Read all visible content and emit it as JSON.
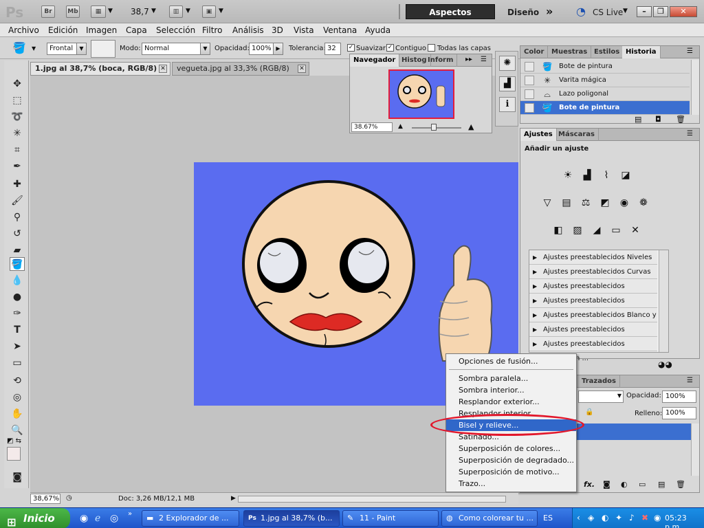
{
  "appbar": {
    "logo": "Ps",
    "btn_br": "Br",
    "btn_mb": "Mb",
    "zoom": "38,7",
    "workspace_active": "Aspectos esenciales",
    "workspace_design": "Diseño",
    "more": "»",
    "cslive": "CS Live"
  },
  "menu": [
    "Archivo",
    "Edición",
    "Imagen",
    "Capa",
    "Selección",
    "Filtro",
    "Análisis",
    "3D",
    "Vista",
    "Ventana",
    "Ayuda"
  ],
  "options": {
    "fill_source": "Frontal",
    "mode_label": "Modo:",
    "mode_value": "Normal",
    "opacity_label": "Opacidad:",
    "opacity_value": "100%",
    "tolerance_label": "Tolerancia:",
    "tolerance_value": "32",
    "antialias_label": "Suavizar",
    "contiguous_label": "Contiguo",
    "all_layers_label": "Todas las capas"
  },
  "tabs": [
    {
      "label": "1.jpg al 38,7% (boca, RGB/8) *"
    },
    {
      "label": "vegueta.jpg al 33,3% (RGB/8)"
    }
  ],
  "navigator": {
    "tabs": [
      "Navegador",
      "Histog",
      "Inform"
    ],
    "zoom": "38.67%"
  },
  "history": {
    "tabs": [
      "Color",
      "Muestras",
      "Estilos",
      "Historia"
    ],
    "items": [
      {
        "label": "Bote de pintura",
        "icon": "paint-bucket-icon"
      },
      {
        "label": "Varita mágica",
        "icon": "magic-wand-icon"
      },
      {
        "label": "Lazo poligonal",
        "icon": "polygonal-lasso-icon"
      },
      {
        "label": "Bote de pintura",
        "icon": "paint-bucket-icon"
      }
    ],
    "selected_index": 3
  },
  "ajustes": {
    "tabs": [
      "Ajustes",
      "Máscaras"
    ],
    "subtitle": "Añadir un ajuste",
    "presets": [
      "Ajustes preestablecidos Niveles",
      "Ajustes preestablecidos Curvas",
      "Ajustes preestablecidos Exposición",
      "Ajustes preestablecidos Tono/satur...",
      "Ajustes preestablecidos Blanco y ne...",
      "Ajustes preestablecidos Mezclador ...",
      "Ajustes preestablecidos Corrección ..."
    ]
  },
  "layers": {
    "tab": "Trazados",
    "opacity_label": "Opacidad:",
    "opacity_value": "100%",
    "fill_label": "Relleno:",
    "fill_value": "100%"
  },
  "context_menu": {
    "items": [
      "Opciones de fusión...",
      "Sombra paralela...",
      "Sombra interior...",
      "Resplandor exterior...",
      "Resplandor interior...",
      "Bisel y relieve...",
      "Satinado...",
      "Superposición de colores...",
      "Superposición de degradado...",
      "Superposición de motivo...",
      "Trazo..."
    ],
    "hover_index": 5
  },
  "status": {
    "zoom": "38,67%",
    "doc": "Doc: 3,26 MB/12,1 MB"
  },
  "taskbar": {
    "start": "Inicio",
    "tasks": [
      "2 Explorador de ...",
      "1.jpg al 38,7% (b...",
      "11 - Paint",
      "Como colorear tu ..."
    ],
    "lang": "ES",
    "clock": "05:23 p.m."
  },
  "colors": {
    "canvas_bg": "#5a6cf0",
    "selection": "#3067c9",
    "annotation": "#e2172b",
    "skin": "#f6d6b0"
  }
}
